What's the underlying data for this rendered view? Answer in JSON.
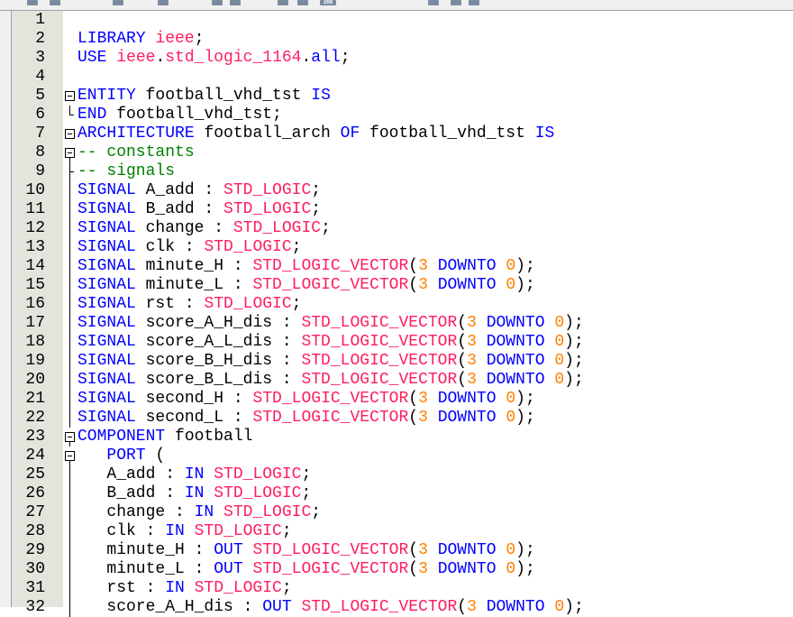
{
  "colors": {
    "keyword": "#0000ff",
    "type": "#ff1d5e",
    "number": "#ff7f00",
    "comment": "#008000"
  },
  "toolbar": {
    "counter": "268"
  },
  "lines": [
    {
      "n": "1",
      "fold": "",
      "tokens": []
    },
    {
      "n": "2",
      "fold": "",
      "tokens": [
        [
          "k",
          "LIBRARY "
        ],
        [
          "t",
          "ieee"
        ],
        [
          "p",
          ";"
        ]
      ]
    },
    {
      "n": "3",
      "fold": "",
      "tokens": [
        [
          "k",
          "USE "
        ],
        [
          "t",
          "ieee"
        ],
        [
          "p",
          "."
        ],
        [
          "t",
          "std_logic_1164"
        ],
        [
          "p",
          "."
        ],
        [
          "k",
          "all"
        ],
        [
          "p",
          ";"
        ]
      ]
    },
    {
      "n": "4",
      "fold": "",
      "tokens": []
    },
    {
      "n": "5",
      "fold": "box",
      "tokens": [
        [
          "k",
          "ENTITY "
        ],
        [
          "p",
          "football_vhd_tst "
        ],
        [
          "k",
          "IS"
        ]
      ]
    },
    {
      "n": "6",
      "fold": "end",
      "tokens": [
        [
          "k",
          "END "
        ],
        [
          "p",
          "football_vhd_tst;"
        ]
      ]
    },
    {
      "n": "7",
      "fold": "box",
      "tokens": [
        [
          "k",
          "ARCHITECTURE "
        ],
        [
          "p",
          "football_arch "
        ],
        [
          "k",
          "OF "
        ],
        [
          "p",
          "football_vhd_tst "
        ],
        [
          "k",
          "IS"
        ]
      ]
    },
    {
      "n": "8",
      "fold": "box",
      "tokens": [
        [
          "c",
          "-- constants"
        ]
      ]
    },
    {
      "n": "9",
      "fold": "mid",
      "tokens": [
        [
          "c",
          "-- signals"
        ]
      ]
    },
    {
      "n": "10",
      "fold": "line",
      "tokens": [
        [
          "k",
          "SIGNAL "
        ],
        [
          "p",
          "A_add : "
        ],
        [
          "t",
          "STD_LOGIC"
        ],
        [
          "p",
          ";"
        ]
      ]
    },
    {
      "n": "11",
      "fold": "line",
      "tokens": [
        [
          "k",
          "SIGNAL "
        ],
        [
          "p",
          "B_add : "
        ],
        [
          "t",
          "STD_LOGIC"
        ],
        [
          "p",
          ";"
        ]
      ]
    },
    {
      "n": "12",
      "fold": "line",
      "tokens": [
        [
          "k",
          "SIGNAL "
        ],
        [
          "p",
          "change : "
        ],
        [
          "t",
          "STD_LOGIC"
        ],
        [
          "p",
          ";"
        ]
      ]
    },
    {
      "n": "13",
      "fold": "line",
      "tokens": [
        [
          "k",
          "SIGNAL "
        ],
        [
          "p",
          "clk : "
        ],
        [
          "t",
          "STD_LOGIC"
        ],
        [
          "p",
          ";"
        ]
      ]
    },
    {
      "n": "14",
      "fold": "line",
      "tokens": [
        [
          "k",
          "SIGNAL "
        ],
        [
          "p",
          "minute_H : "
        ],
        [
          "t",
          "STD_LOGIC_VECTOR"
        ],
        [
          "p",
          "("
        ],
        [
          "n",
          "3"
        ],
        [
          "k",
          " DOWNTO "
        ],
        [
          "n",
          "0"
        ],
        [
          "p",
          ");"
        ]
      ]
    },
    {
      "n": "15",
      "fold": "line",
      "tokens": [
        [
          "k",
          "SIGNAL "
        ],
        [
          "p",
          "minute_L : "
        ],
        [
          "t",
          "STD_LOGIC_VECTOR"
        ],
        [
          "p",
          "("
        ],
        [
          "n",
          "3"
        ],
        [
          "k",
          " DOWNTO "
        ],
        [
          "n",
          "0"
        ],
        [
          "p",
          ");"
        ]
      ]
    },
    {
      "n": "16",
      "fold": "line",
      "tokens": [
        [
          "k",
          "SIGNAL "
        ],
        [
          "p",
          "rst : "
        ],
        [
          "t",
          "STD_LOGIC"
        ],
        [
          "p",
          ";"
        ]
      ]
    },
    {
      "n": "17",
      "fold": "line",
      "tokens": [
        [
          "k",
          "SIGNAL "
        ],
        [
          "p",
          "score_A_H_dis : "
        ],
        [
          "t",
          "STD_LOGIC_VECTOR"
        ],
        [
          "p",
          "("
        ],
        [
          "n",
          "3"
        ],
        [
          "k",
          " DOWNTO "
        ],
        [
          "n",
          "0"
        ],
        [
          "p",
          ");"
        ]
      ]
    },
    {
      "n": "18",
      "fold": "line",
      "tokens": [
        [
          "k",
          "SIGNAL "
        ],
        [
          "p",
          "score_A_L_dis : "
        ],
        [
          "t",
          "STD_LOGIC_VECTOR"
        ],
        [
          "p",
          "("
        ],
        [
          "n",
          "3"
        ],
        [
          "k",
          " DOWNTO "
        ],
        [
          "n",
          "0"
        ],
        [
          "p",
          ");"
        ]
      ]
    },
    {
      "n": "19",
      "fold": "line",
      "tokens": [
        [
          "k",
          "SIGNAL "
        ],
        [
          "p",
          "score_B_H_dis : "
        ],
        [
          "t",
          "STD_LOGIC_VECTOR"
        ],
        [
          "p",
          "("
        ],
        [
          "n",
          "3"
        ],
        [
          "k",
          " DOWNTO "
        ],
        [
          "n",
          "0"
        ],
        [
          "p",
          ");"
        ]
      ]
    },
    {
      "n": "20",
      "fold": "line",
      "tokens": [
        [
          "k",
          "SIGNAL "
        ],
        [
          "p",
          "score_B_L_dis : "
        ],
        [
          "t",
          "STD_LOGIC_VECTOR"
        ],
        [
          "p",
          "("
        ],
        [
          "n",
          "3"
        ],
        [
          "k",
          " DOWNTO "
        ],
        [
          "n",
          "0"
        ],
        [
          "p",
          ");"
        ]
      ]
    },
    {
      "n": "21",
      "fold": "line",
      "tokens": [
        [
          "k",
          "SIGNAL "
        ],
        [
          "p",
          "second_H : "
        ],
        [
          "t",
          "STD_LOGIC_VECTOR"
        ],
        [
          "p",
          "("
        ],
        [
          "n",
          "3"
        ],
        [
          "k",
          " DOWNTO "
        ],
        [
          "n",
          "0"
        ],
        [
          "p",
          ");"
        ]
      ]
    },
    {
      "n": "22",
      "fold": "line",
      "tokens": [
        [
          "k",
          "SIGNAL "
        ],
        [
          "p",
          "second_L : "
        ],
        [
          "t",
          "STD_LOGIC_VECTOR"
        ],
        [
          "p",
          "("
        ],
        [
          "n",
          "3"
        ],
        [
          "k",
          " DOWNTO "
        ],
        [
          "n",
          "0"
        ],
        [
          "p",
          ");"
        ]
      ]
    },
    {
      "n": "23",
      "fold": "box",
      "tokens": [
        [
          "k",
          "COMPONENT "
        ],
        [
          "p",
          "football"
        ]
      ]
    },
    {
      "n": "24",
      "fold": "box",
      "tokens": [
        [
          "p",
          "   "
        ],
        [
          "k",
          "PORT "
        ],
        [
          "p",
          "("
        ]
      ]
    },
    {
      "n": "25",
      "fold": "line",
      "tokens": [
        [
          "p",
          "   A_add : "
        ],
        [
          "k",
          "IN "
        ],
        [
          "t",
          "STD_LOGIC"
        ],
        [
          "p",
          ";"
        ]
      ]
    },
    {
      "n": "26",
      "fold": "line",
      "tokens": [
        [
          "p",
          "   B_add : "
        ],
        [
          "k",
          "IN "
        ],
        [
          "t",
          "STD_LOGIC"
        ],
        [
          "p",
          ";"
        ]
      ]
    },
    {
      "n": "27",
      "fold": "line",
      "tokens": [
        [
          "p",
          "   change : "
        ],
        [
          "k",
          "IN "
        ],
        [
          "t",
          "STD_LOGIC"
        ],
        [
          "p",
          ";"
        ]
      ]
    },
    {
      "n": "28",
      "fold": "line",
      "tokens": [
        [
          "p",
          "   clk : "
        ],
        [
          "k",
          "IN "
        ],
        [
          "t",
          "STD_LOGIC"
        ],
        [
          "p",
          ";"
        ]
      ]
    },
    {
      "n": "29",
      "fold": "line",
      "tokens": [
        [
          "p",
          "   minute_H : "
        ],
        [
          "k",
          "OUT "
        ],
        [
          "t",
          "STD_LOGIC_VECTOR"
        ],
        [
          "p",
          "("
        ],
        [
          "n",
          "3"
        ],
        [
          "k",
          " DOWNTO "
        ],
        [
          "n",
          "0"
        ],
        [
          "p",
          ");"
        ]
      ]
    },
    {
      "n": "30",
      "fold": "line",
      "tokens": [
        [
          "p",
          "   minute_L : "
        ],
        [
          "k",
          "OUT "
        ],
        [
          "t",
          "STD_LOGIC_VECTOR"
        ],
        [
          "p",
          "("
        ],
        [
          "n",
          "3"
        ],
        [
          "k",
          " DOWNTO "
        ],
        [
          "n",
          "0"
        ],
        [
          "p",
          ");"
        ]
      ]
    },
    {
      "n": "31",
      "fold": "line",
      "tokens": [
        [
          "p",
          "   rst : "
        ],
        [
          "k",
          "IN "
        ],
        [
          "t",
          "STD_LOGIC"
        ],
        [
          "p",
          ";"
        ]
      ]
    },
    {
      "n": "32",
      "fold": "line",
      "tokens": [
        [
          "p",
          "   score_A_H_dis : "
        ],
        [
          "k",
          "OUT "
        ],
        [
          "t",
          "STD_LOGIC_VECTOR"
        ],
        [
          "p",
          "("
        ],
        [
          "n",
          "3"
        ],
        [
          "k",
          " DOWNTO "
        ],
        [
          "n",
          "0"
        ],
        [
          "p",
          ");"
        ]
      ]
    }
  ]
}
